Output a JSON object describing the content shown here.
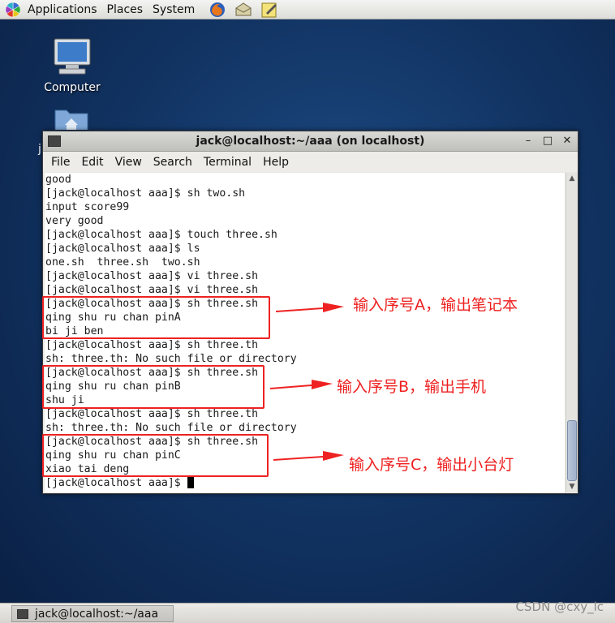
{
  "top_panel": {
    "menus": [
      "Applications",
      "Places",
      "System"
    ],
    "launchers": [
      "firefox-icon",
      "mail-icon",
      "notes-icon"
    ]
  },
  "desktop": {
    "icons": [
      {
        "label": "Computer",
        "icon": "computer-icon"
      },
      {
        "label": "j",
        "icon": "home-folder-icon"
      }
    ]
  },
  "window": {
    "title": "jack@localhost:~/aaa (on localhost)",
    "controls": [
      "–",
      "□",
      "✕"
    ],
    "menus": [
      "File",
      "Edit",
      "View",
      "Search",
      "Terminal",
      "Help"
    ]
  },
  "terminal": {
    "lines": [
      "good",
      "[jack@localhost aaa]$ sh two.sh",
      "input score99",
      "very good",
      "[jack@localhost aaa]$ touch three.sh",
      "[jack@localhost aaa]$ ls",
      "one.sh  three.sh  two.sh",
      "[jack@localhost aaa]$ vi three.sh",
      "[jack@localhost aaa]$ vi three.sh",
      "[jack@localhost aaa]$ sh three.sh",
      "qing shu ru chan pinA",
      "bi ji ben",
      "[jack@localhost aaa]$ sh three.th",
      "sh: three.th: No such file or directory",
      "[jack@localhost aaa]$ sh three.sh",
      "qing shu ru chan pinB",
      "shu ji",
      "[jack@localhost aaa]$ sh three.th",
      "sh: three.th: No such file or directory",
      "[jack@localhost aaa]$ sh three.sh",
      "qing shu ru chan pinC",
      "xiao tai deng"
    ],
    "prompt": "[jack@localhost aaa]$ "
  },
  "annotations": [
    "输入序号A，输出笔记本",
    "输入序号B，输出手机",
    "输入序号C，输出小台灯"
  ],
  "annotation_color": "#ee2222",
  "taskbar": {
    "task_label": "jack@localhost:~/aaa"
  },
  "watermark": "CSDN @cxy_lc"
}
